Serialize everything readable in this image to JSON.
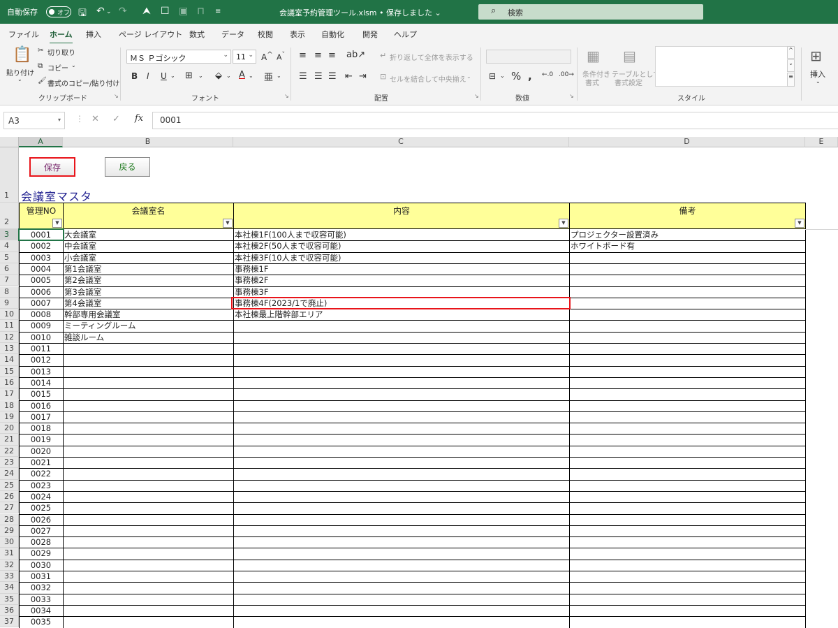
{
  "titlebar": {
    "autosave_label": "自動保存",
    "autosave_state": "オフ",
    "document_title": "会議室予約管理ツール.xlsm • 保存しました ⌄",
    "search_placeholder": "検索"
  },
  "menu_tabs": [
    "ファイル",
    "ホーム",
    "挿入",
    "ページ レイアウト",
    "数式",
    "データ",
    "校閲",
    "表示",
    "自動化",
    "開発",
    "ヘルプ"
  ],
  "active_tab": "ホーム",
  "ribbon": {
    "clipboard": {
      "paste": "貼り付け",
      "cut": "切り取り",
      "copy": "コピー",
      "format_painter": "書式のコピー/貼り付け",
      "group_label": "クリップボード"
    },
    "font": {
      "font_name": "ＭＳ Ｐゴシック",
      "font_size": "11",
      "group_label": "フォント"
    },
    "alignment": {
      "wrap_text": "折り返して全体を表示する",
      "merge_center": "セルを結合して中央揃え",
      "group_label": "配置"
    },
    "number": {
      "group_label": "数値"
    },
    "styles": {
      "conditional": "条件付き",
      "conditional2": "書式",
      "table": "テーブルとして",
      "table2": "書式設定",
      "group_label": "スタイル"
    },
    "cells": {
      "insert": "挿入"
    }
  },
  "formula_bar": {
    "name_box": "A3",
    "formula": "0001"
  },
  "columns": [
    "A",
    "B",
    "C",
    "D",
    "E"
  ],
  "buttons": {
    "save": "保存",
    "back": "戻る"
  },
  "colors": {
    "excel_green": "#217346",
    "header_fill": "#ffff99",
    "highlight_red": "#e8141a",
    "save_text": "#7a2a6e",
    "back_text": "#1f7a1f"
  },
  "sheet_title": "会議室マスタ",
  "table": {
    "headers": [
      "管理NO",
      "会議室名",
      "内容",
      "備考"
    ],
    "rows": [
      [
        "0001",
        "大会議室",
        "本社棟1F(100人まで収容可能)",
        "プロジェクター設置済み"
      ],
      [
        "0002",
        "中会議室",
        "本社棟2F(50人まで収容可能)",
        "ホワイトボード有"
      ],
      [
        "0003",
        "小会議室",
        "本社棟3F(10人まで収容可能)",
        ""
      ],
      [
        "0004",
        "第1会議室",
        "事務棟1F",
        ""
      ],
      [
        "0005",
        "第2会議室",
        "事務棟2F",
        ""
      ],
      [
        "0006",
        "第3会議室",
        "事務棟3F",
        ""
      ],
      [
        "0007",
        "第4会議室",
        "事務棟4F(2023/1で廃止)",
        ""
      ],
      [
        "0008",
        "幹部専用会議室",
        "本社棟最上階幹部エリア",
        ""
      ],
      [
        "0009",
        "ミーティングルーム",
        "",
        ""
      ],
      [
        "0010",
        "雑談ルーム",
        "",
        ""
      ],
      [
        "0011",
        "",
        "",
        ""
      ],
      [
        "0012",
        "",
        "",
        ""
      ],
      [
        "0013",
        "",
        "",
        ""
      ],
      [
        "0014",
        "",
        "",
        ""
      ],
      [
        "0015",
        "",
        "",
        ""
      ],
      [
        "0016",
        "",
        "",
        ""
      ],
      [
        "0017",
        "",
        "",
        ""
      ],
      [
        "0018",
        "",
        "",
        ""
      ],
      [
        "0019",
        "",
        "",
        ""
      ],
      [
        "0020",
        "",
        "",
        ""
      ],
      [
        "0021",
        "",
        "",
        ""
      ],
      [
        "0022",
        "",
        "",
        ""
      ],
      [
        "0023",
        "",
        "",
        ""
      ],
      [
        "0024",
        "",
        "",
        ""
      ],
      [
        "0025",
        "",
        "",
        ""
      ],
      [
        "0026",
        "",
        "",
        ""
      ],
      [
        "0027",
        "",
        "",
        ""
      ],
      [
        "0028",
        "",
        "",
        ""
      ],
      [
        "0029",
        "",
        "",
        ""
      ],
      [
        "0030",
        "",
        "",
        ""
      ],
      [
        "0031",
        "",
        "",
        ""
      ],
      [
        "0032",
        "",
        "",
        ""
      ],
      [
        "0033",
        "",
        "",
        ""
      ],
      [
        "0034",
        "",
        "",
        ""
      ],
      [
        "0035",
        "",
        "",
        ""
      ]
    ]
  }
}
